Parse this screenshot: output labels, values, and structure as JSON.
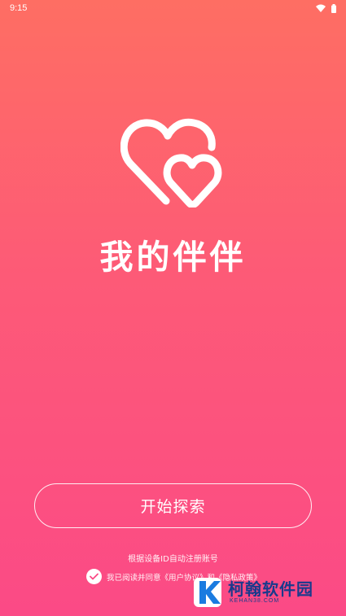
{
  "status_bar": {
    "time": "9:15",
    "wifi_icon": "wifi-icon",
    "battery_icon": "battery-icon"
  },
  "logo": {
    "icon": "double-heart-icon"
  },
  "app_name": "我的伴伴",
  "start_button": {
    "label": "开始探索"
  },
  "device_note": "根据设备ID自动注册账号",
  "agreement": {
    "checked": true,
    "text": "我已阅读并同意《用户协议》和《隐私政策》"
  },
  "watermark": {
    "title": "柯翰软件园",
    "subtitle": "KEHAN38.COM"
  },
  "colors": {
    "gradient_top": "#fe6e63",
    "gradient_bottom": "#fb4a86",
    "accent_text": "#ffffff",
    "check_mark": "#fb4a86",
    "watermark_blue": "#1a3a8c"
  }
}
